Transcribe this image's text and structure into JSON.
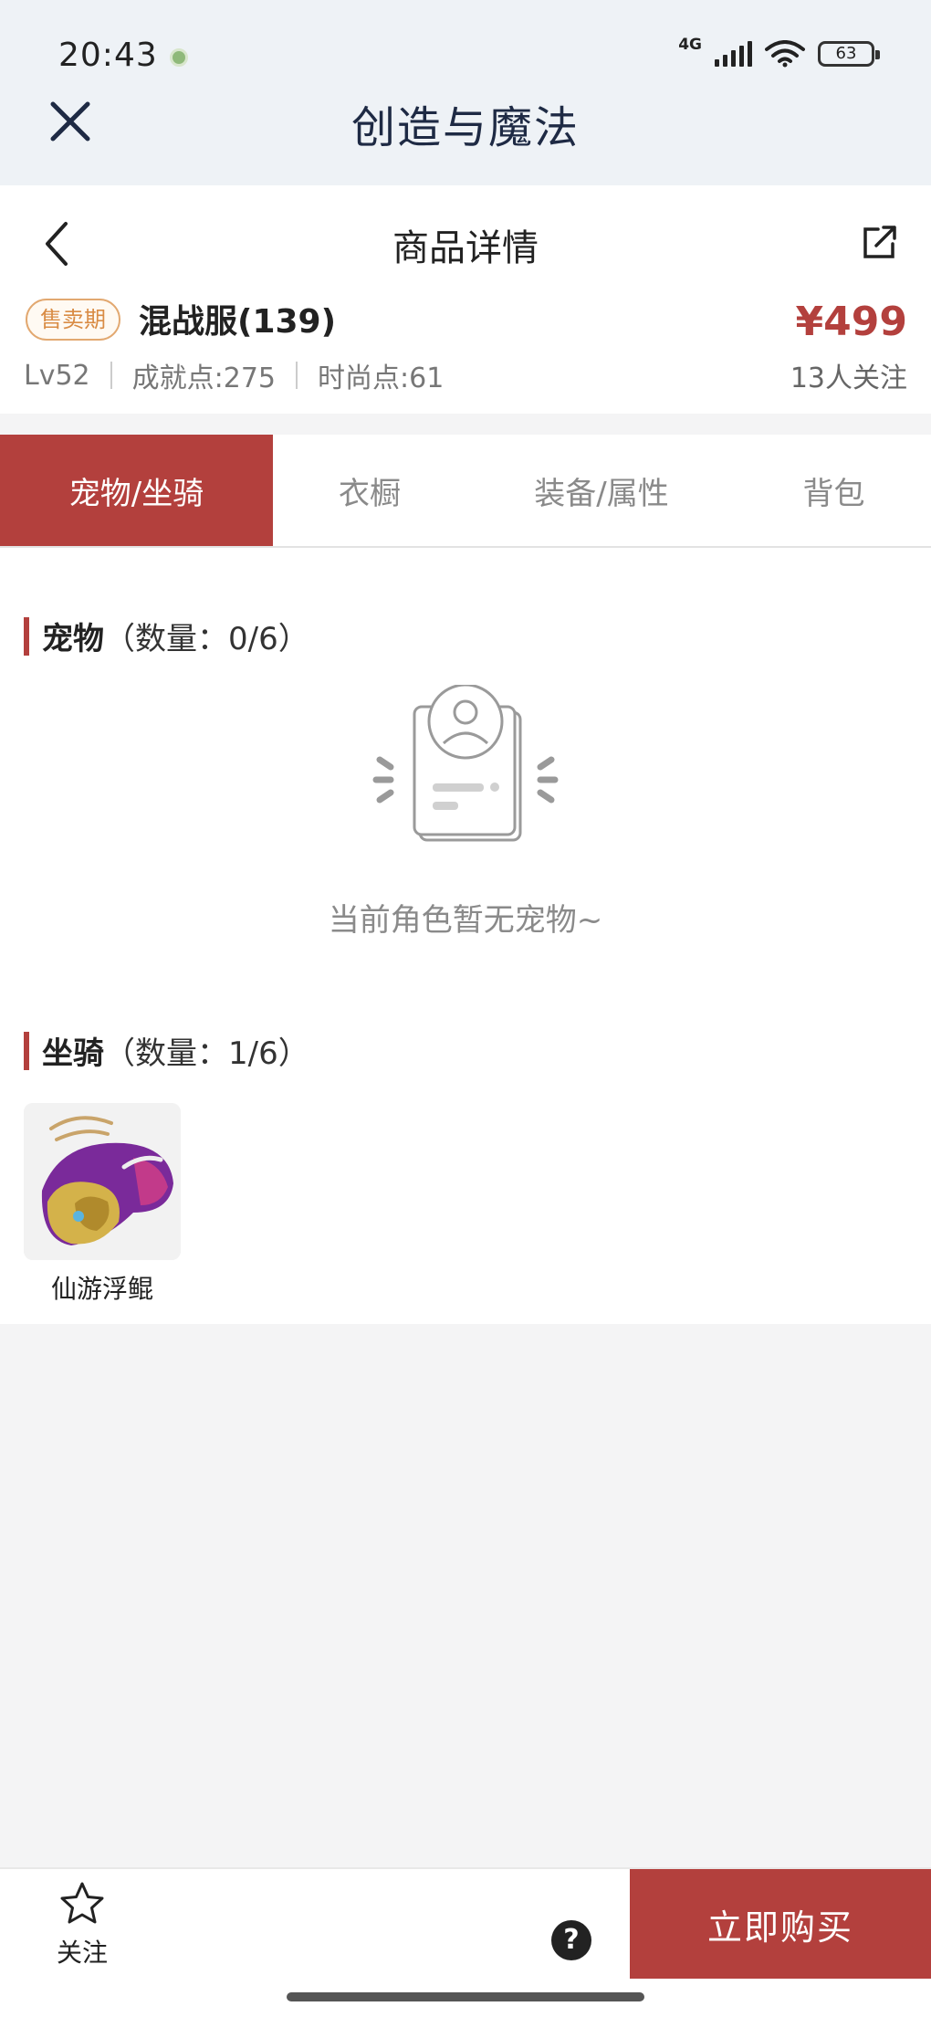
{
  "status_bar": {
    "time": "20:43",
    "network": "4G",
    "battery": "63"
  },
  "app": {
    "title": "创造与魔法"
  },
  "product": {
    "page_title": "商品详情",
    "badge": "售卖期",
    "server": "混战服(139)",
    "price": "¥499",
    "level": "Lv52",
    "achievement": "成就点:275",
    "fashion": "时尚点:61",
    "followers": "13人关注"
  },
  "tabs": [
    {
      "label": "宠物/坐骑",
      "active": true
    },
    {
      "label": "衣橱",
      "active": false
    },
    {
      "label": "装备/属性",
      "active": false
    },
    {
      "label": "背包",
      "active": false
    }
  ],
  "pets": {
    "title": "宠物",
    "count": "（数量：0/6）",
    "empty_text": "当前角色暂无宠物~"
  },
  "mounts": {
    "title": "坐骑",
    "count": "（数量：1/6）",
    "items": [
      {
        "name": "仙游浮鲲"
      }
    ]
  },
  "bottom_bar": {
    "follow_label": "关注",
    "help_symbol": "?",
    "buy_label": "立即购买"
  },
  "colors": {
    "accent": "#b3403d",
    "badge": "#d98c45",
    "header_bg": "#eef2f6"
  }
}
